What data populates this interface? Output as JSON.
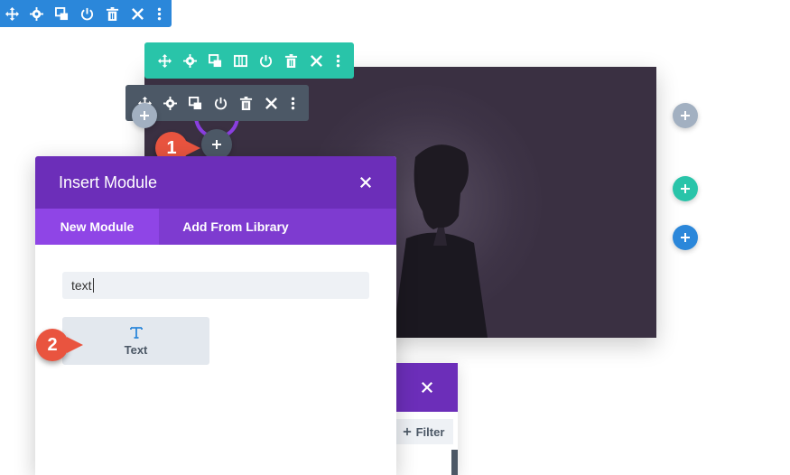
{
  "colors": {
    "blue": "#2b87da",
    "teal": "#29c4a9",
    "dark_gray": "#4c5866",
    "light_gray_btn": "#a2b0c1",
    "purple_dark": "#6c2eb9",
    "purple_light": "#7e3bd0",
    "callout_red": "#e9543f",
    "photo_bg": "#3a3042"
  },
  "section_toolbar": {
    "icons": [
      "move-icon",
      "gear-icon",
      "duplicate-icon",
      "power-icon",
      "trash-icon",
      "close-icon",
      "more-icon"
    ]
  },
  "row_toolbar": {
    "icons": [
      "move-icon",
      "gear-icon",
      "duplicate-icon",
      "columns-icon",
      "power-icon",
      "trash-icon",
      "close-icon",
      "more-icon"
    ]
  },
  "module_toolbar": {
    "icons": [
      "move-icon",
      "gear-icon",
      "duplicate-icon",
      "power-icon",
      "trash-icon",
      "close-icon",
      "more-icon"
    ]
  },
  "callouts": {
    "one": "1",
    "two": "2"
  },
  "insert_modal": {
    "title": "Insert Module",
    "tabs": [
      {
        "label": "New Module",
        "active": true
      },
      {
        "label": "Add From Library",
        "active": false
      }
    ],
    "search": {
      "value": "text",
      "placeholder": ""
    },
    "results": [
      {
        "label": "Text",
        "icon": "text-t-icon"
      }
    ]
  },
  "back_panel": {
    "filter_label": "Filter"
  }
}
